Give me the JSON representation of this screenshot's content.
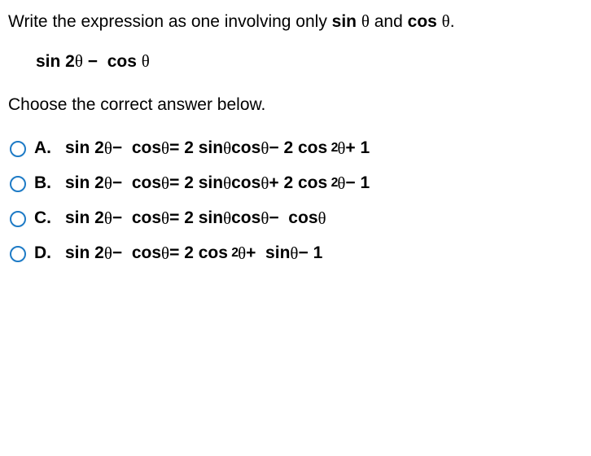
{
  "question": {
    "prefix": "Write the expression as one involving only ",
    "func1": "sin",
    "theta1": "θ",
    "mid": " and ",
    "func2": "cos",
    "theta2": "θ",
    "suffix": "."
  },
  "expression": {
    "text": "sin 2θ − cos θ"
  },
  "choose": "Choose the correct answer below.",
  "options": [
    {
      "label": "A.",
      "lhs": "sin 2θ − cos θ = ",
      "rhs_parts": [
        "2 sin θ cos θ − 2 cos",
        "2",
        "θ + 1"
      ]
    },
    {
      "label": "B.",
      "lhs": "sin 2θ − cos θ = ",
      "rhs_parts": [
        "2 sin θ cos θ + 2 cos",
        "2",
        "θ − 1"
      ]
    },
    {
      "label": "C.",
      "lhs": "sin 2θ − cos θ = ",
      "rhs_parts": [
        "2 sin θ cos θ − cos θ",
        "",
        ""
      ]
    },
    {
      "label": "D.",
      "lhs": "sin 2θ − cos θ = ",
      "rhs_parts": [
        "2 cos",
        "2",
        "θ + sin θ − 1"
      ]
    }
  ]
}
